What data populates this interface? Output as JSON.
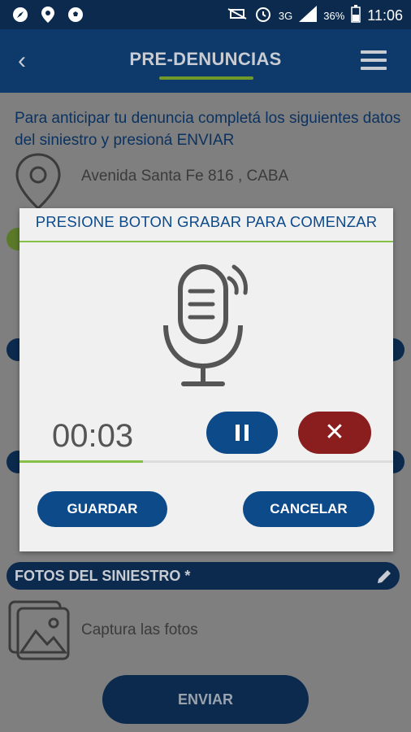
{
  "status_bar": {
    "network": "3G",
    "battery": "36%",
    "time": "11:06"
  },
  "app_bar": {
    "title": "PRE-DENUNCIAS"
  },
  "form": {
    "intro": "Para anticipar tu denuncia completá los siguientes datos del siniestro y presioná ENVIAR",
    "address": "Avenida Santa Fe 816 , CABA",
    "photos_header": "FOTOS DEL SINIESTRO *",
    "photos_caption": "Captura las fotos",
    "submit_label": "ENVIAR"
  },
  "dialog": {
    "title": "PRESIONE BOTON GRABAR PARA COMENZAR",
    "timer": "00:03",
    "progress": 0.33,
    "save_label": "GUARDAR",
    "cancel_label": "CANCELAR"
  },
  "colors": {
    "brand_dark": "#0d3a6b",
    "accent_green": "#86c046",
    "danger": "#8a1d1d"
  }
}
